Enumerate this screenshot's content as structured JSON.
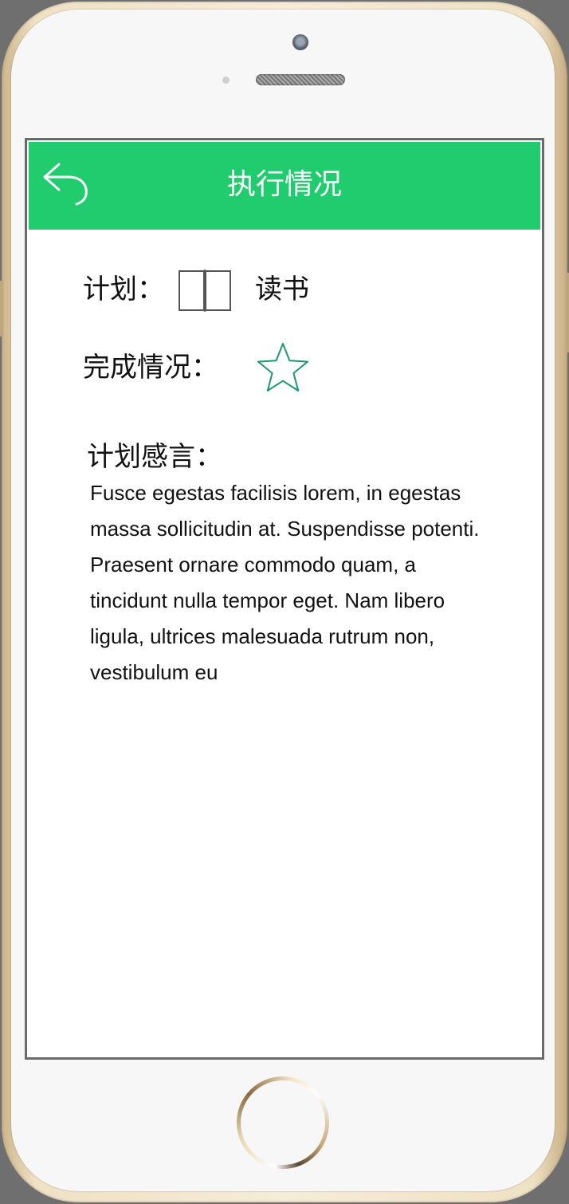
{
  "header": {
    "title": "执行情况",
    "back_icon": "back-arrow-icon",
    "background_color": "#21cc6e"
  },
  "plan": {
    "label": "计划：",
    "icon": "open-book-icon",
    "value": "读书"
  },
  "completion": {
    "label": "完成情况：",
    "icon": "star-outline-icon",
    "icon_color": "#1a9a6a"
  },
  "notes": {
    "label": "计划感言：",
    "text": "Fusce egestas facilisis lorem, in egestas massa sollicitudin at. Suspendisse potenti. Praesent ornare commodo quam, a tincidunt nulla tempor eget. Nam libero ligula, ultrices malesuada rutrum non, vestibulum eu"
  }
}
